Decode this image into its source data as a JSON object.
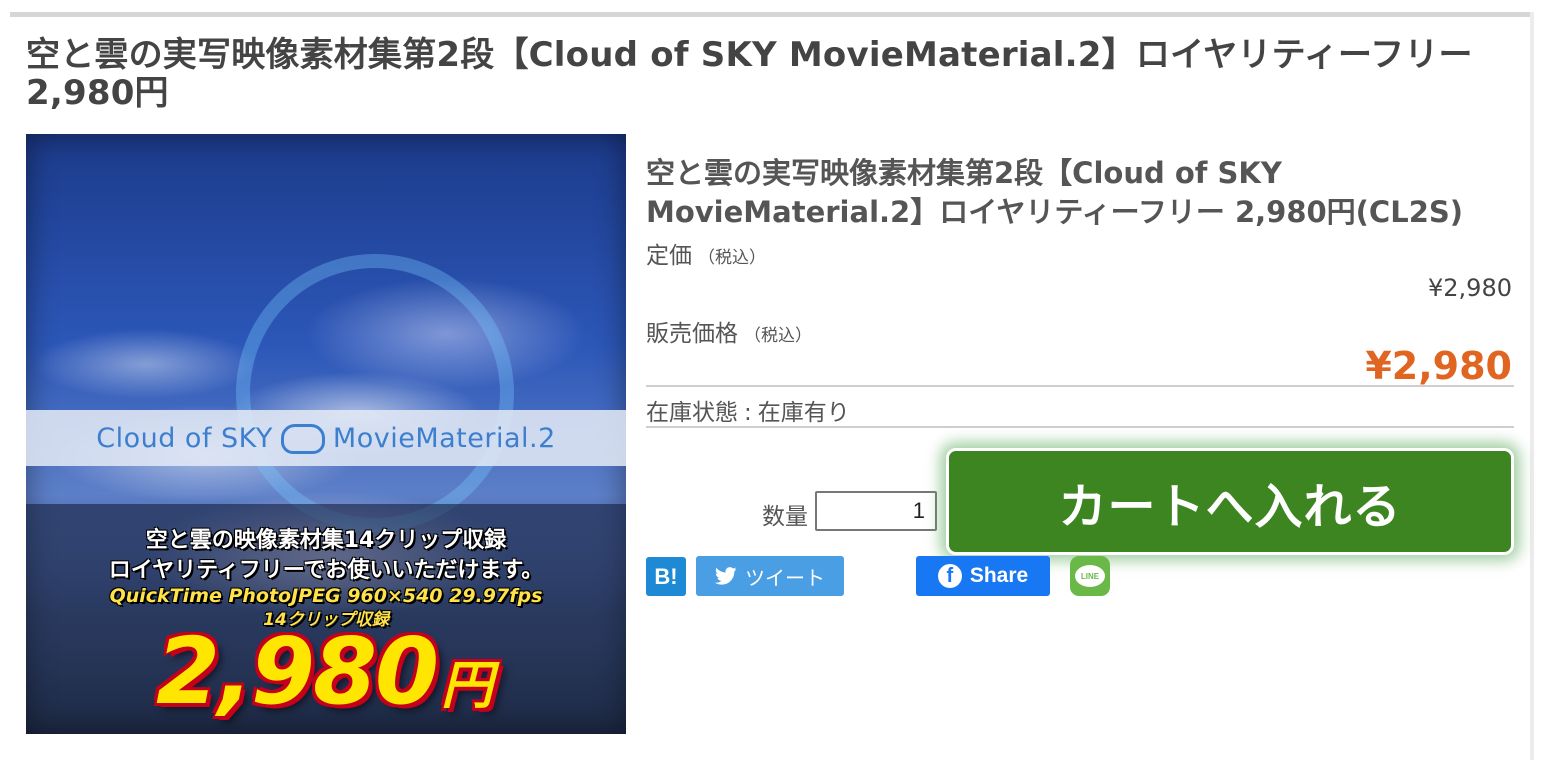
{
  "page": {
    "title": "空と雲の実写映像素材集第2段【Cloud of SKY MovieMaterial.2】ロイヤリティーフリー 2,980円"
  },
  "product_image": {
    "band_text_left": "Cloud of SKY",
    "band_text_right": "MovieMaterial.2",
    "line1": "空と雲の映像素材集14クリップ収録",
    "line2": "ロイヤリティフリーでお使いいただけます。",
    "spec1": "QuickTime PhotoJPEG 960×540 29.97fps",
    "spec2": "14クリップ収録",
    "price_number": "2,980",
    "price_unit": "円"
  },
  "product": {
    "name": "空と雲の実写映像素材集第2段【Cloud of SKY MovieMaterial.2】ロイヤリティーフリー 2,980円(CL2S)",
    "list_price_label": "定価",
    "list_price_note": "（税込）",
    "list_price": "¥2,980",
    "sale_price_label": "販売価格",
    "sale_price_note": "（税込）",
    "sale_price": "¥2,980",
    "stock_label": "在庫状態",
    "stock_sep": ":",
    "stock_value": "在庫有り"
  },
  "purchase": {
    "quantity_label": "数量",
    "quantity_value": "1",
    "cart_button_label": "カートへ入れる"
  },
  "social": {
    "hatena_label": "B!",
    "tweet_label": "ツイート",
    "facebook_label": "Share",
    "line_label": "LINE"
  },
  "colors": {
    "sale_price": "#e06521",
    "cart_button": "#3c8520",
    "twitter": "#4a9ee3",
    "facebook": "#1877f2",
    "hatena": "#1e8ad6",
    "line": "#6ab948"
  }
}
